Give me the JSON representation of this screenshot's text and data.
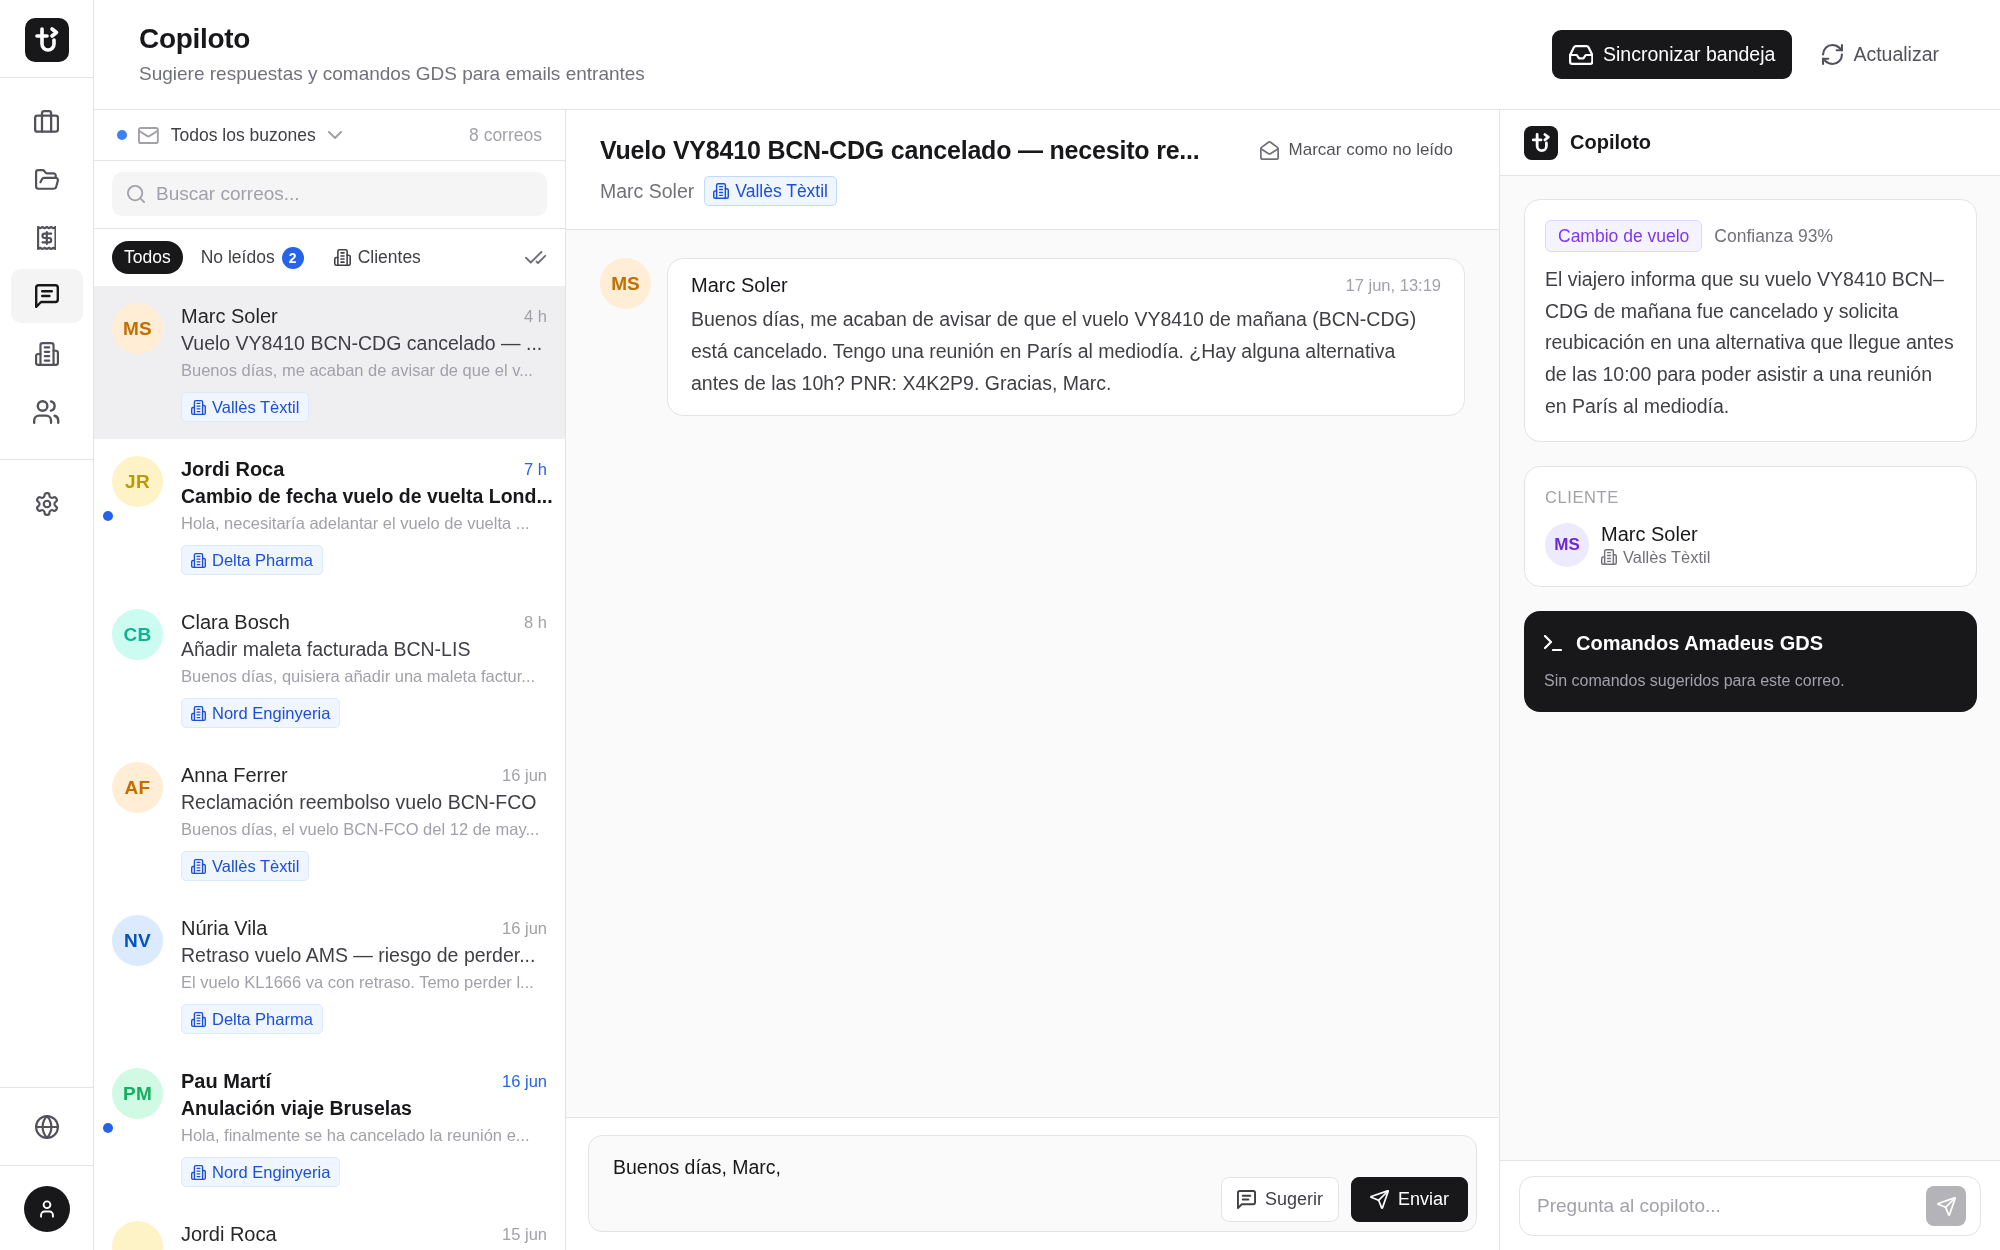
{
  "sidebar": {
    "nav_items": [
      {
        "selected": false
      },
      {
        "selected": false
      },
      {
        "selected": false
      },
      {
        "selected": true
      },
      {
        "selected": false
      },
      {
        "selected": false
      }
    ]
  },
  "header": {
    "title": "Copiloto",
    "subtitle": "Sugiere respuestas y comandos GDS para emails entrantes",
    "buttons": [
      {
        "kind": "primary",
        "label": "Sincronizar bandeja"
      },
      {
        "kind": "ghost",
        "label": "Actualizar"
      }
    ]
  },
  "inbox": {
    "mailbox": "Todos los buzones",
    "count": "8 correos",
    "search": {
      "placeholder": "Buscar correos..."
    },
    "filters": [
      {
        "kind": "plain",
        "label": "Todos",
        "selected": true
      },
      {
        "kind": "count",
        "label": "No leídos",
        "badge": "2",
        "selected": false
      },
      {
        "kind": "client",
        "label": "Clientes",
        "selected": false
      }
    ],
    "emails": [
      {
        "initials": "MS",
        "color": "#ffedd5",
        "sender": "Marc Soler",
        "time": "4 h",
        "subject": "Vuelo VY8410 BCN-CDG cancelado — ...",
        "preview": "Buenos días, me acaban de avisar de que el v...",
        "client": "Vallès Tèxtil",
        "unread": false,
        "selected": true
      },
      {
        "initials": "JR",
        "color": "#fef3c7",
        "sender": "Jordi Roca",
        "time": "7 h",
        "subject": "Cambio de fecha vuelo de vuelta Lond...",
        "preview": "Hola, necesitaría adelantar el vuelo de vuelta ...",
        "client": "Delta Pharma",
        "unread": true,
        "selected": false
      },
      {
        "initials": "CB",
        "color": "#ccfbf1",
        "sender": "Clara Bosch",
        "time": "8 h",
        "subject": "Añadir maleta facturada BCN-LIS",
        "preview": "Buenos días, quisiera añadir una maleta factur...",
        "client": "Nord Enginyeria",
        "unread": false,
        "selected": false
      },
      {
        "initials": "AF",
        "color": "#ffedd5",
        "sender": "Anna Ferrer",
        "time": "16 jun",
        "subject": "Reclamación reembolso vuelo BCN-FCO",
        "preview": "Buenos días, el vuelo BCN-FCO del 12 de may...",
        "client": "Vallès Tèxtil",
        "unread": false,
        "selected": false
      },
      {
        "initials": "NV",
        "color": "#dbeafe",
        "sender": "Núria Vila",
        "time": "16 jun",
        "subject": "Retraso vuelo AMS — riesgo de perder...",
        "preview": "El vuelo KL1666 va con retraso. Temo perder l...",
        "client": "Delta Pharma",
        "unread": false,
        "selected": false
      },
      {
        "initials": "PM",
        "color": "#d1fae5",
        "sender": "Pau Martí",
        "time": "16 jun",
        "subject": "Anulación viaje Bruselas",
        "preview": "Hola, finalmente se ha cancelado la reunión e...",
        "client": "Nord Enginyeria",
        "unread": true,
        "selected": false
      },
      {
        "color": "#fef3c7",
        "sender": "Jordi Roca",
        "time": "15 jun",
        "unread": false,
        "selected": false
      }
    ]
  },
  "message": {
    "subject": "Vuelo VY8410 BCN-CDG cancelado — necesito re...",
    "mark_unread": "Marcar como no leído",
    "from": "Marc Soler",
    "client": "Vallès Tèxtil",
    "thread": [
      {
        "initials": "MS",
        "color": "#ffedd5",
        "sender": "Marc Soler",
        "time": "17 jun, 13:19",
        "body": "Buenos días, me acaban de avisar de que el vuelo VY8410 de mañana (BCN-CDG) está cancelado. Tengo una reunión en París al mediodía. ¿Hay alguna alternativa antes de las 10h? PNR: X4K2P9. Gracias, Marc."
      }
    ],
    "reply": {
      "value": "Buenos días, Marc,",
      "buttons": [
        {
          "kind": "secondary",
          "label": "Sugerir"
        },
        {
          "kind": "primary",
          "label": "Enviar"
        }
      ]
    }
  },
  "copilot": {
    "title": "Copiloto",
    "analysis": {
      "category": "Cambio de vuelo",
      "confidence": "Confianza 93%",
      "summary": "El viajero informa que su vuelo VY8410 BCN–CDG de mañana fue cancelado y solicita reubicación en una alternativa que llegue antes de las 10:00 para poder asistir a una reunión en París al mediodía."
    },
    "client": {
      "heading": "CLIENTE",
      "initials": "MS",
      "name": "Marc Soler",
      "company": "Vallès Tèxtil"
    },
    "gds": {
      "title": "Comandos Amadeus GDS",
      "empty": "Sin comandos sugeridos para este correo."
    },
    "ask": {
      "placeholder": "Pregunta al copiloto..."
    }
  }
}
